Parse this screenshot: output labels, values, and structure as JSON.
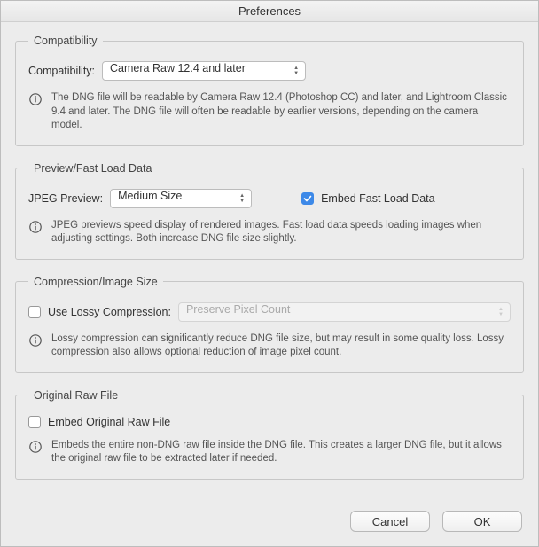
{
  "window": {
    "title": "Preferences"
  },
  "groups": {
    "compatibility": {
      "legend": "Compatibility",
      "label": "Compatibility:",
      "selected": "Camera Raw 12.4 and later",
      "info": "The DNG file will be readable by Camera Raw 12.4 (Photoshop CC) and later, and Lightroom Classic 9.4 and later. The DNG file will often be readable by earlier versions, depending on the camera model."
    },
    "preview": {
      "legend": "Preview/Fast Load Data",
      "jpeg_label": "JPEG Preview:",
      "jpeg_selected": "Medium Size",
      "embed_fast_label": "Embed Fast Load Data",
      "embed_fast_checked": true,
      "info": "JPEG previews speed display of rendered images.  Fast load data speeds loading images when adjusting settings.  Both increase DNG file size slightly."
    },
    "compression": {
      "legend": "Compression/Image Size",
      "lossy_label": "Use Lossy Compression:",
      "lossy_checked": false,
      "preserve_selected": "Preserve Pixel Count",
      "info": "Lossy compression can significantly reduce DNG file size, but may result in some quality loss. Lossy compression also allows optional reduction of image pixel count."
    },
    "original": {
      "legend": "Original Raw File",
      "embed_label": "Embed Original Raw File",
      "embed_checked": false,
      "info": "Embeds the entire non-DNG raw file inside the DNG file.  This creates a larger DNG file, but it allows the original raw file to be extracted later if needed."
    }
  },
  "footer": {
    "cancel": "Cancel",
    "ok": "OK"
  }
}
